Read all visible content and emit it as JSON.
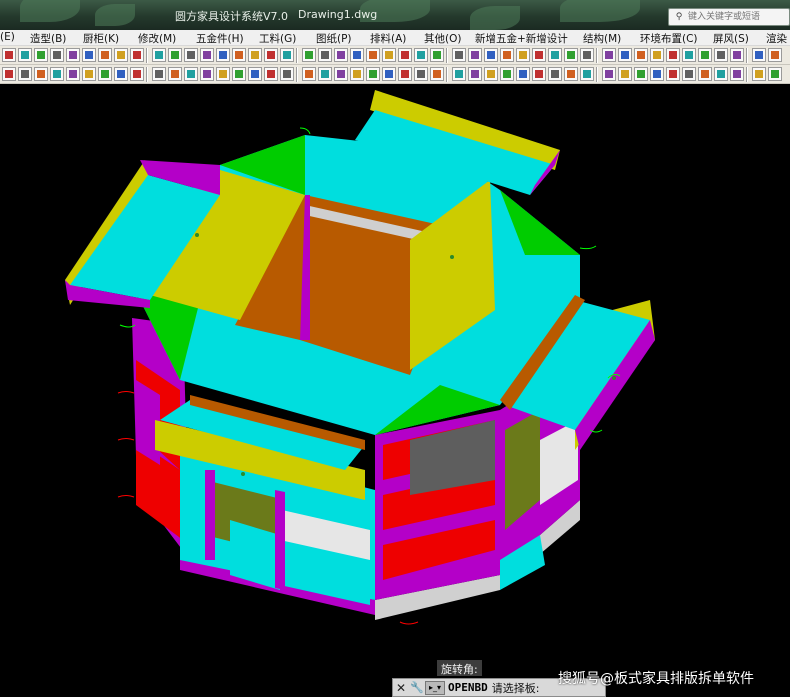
{
  "window": {
    "app_title": "圆方家具设计系统V7.0",
    "document_title": "Drawing1.dwg",
    "help_search_placeholder": "键入关键字或短语"
  },
  "menu": {
    "items": [
      {
        "label": "(E)"
      },
      {
        "label": "造型(B)"
      },
      {
        "label": "厨柜(K)"
      },
      {
        "label": "修改(M)"
      },
      {
        "label": "五金件(H)"
      },
      {
        "label": "工料(G)"
      },
      {
        "label": "图纸(P)"
      },
      {
        "label": "排料(A)"
      },
      {
        "label": "其他(O)"
      },
      {
        "label": "新增五金+新增设计"
      },
      {
        "label": "结构(M)"
      },
      {
        "label": "环境布置(C)"
      },
      {
        "label": "屏风(S)"
      },
      {
        "label": "渲染"
      }
    ]
  },
  "command": {
    "prompt_label": "旋转角:",
    "close_icon": "close-icon",
    "wrench_icon": "wrench-icon",
    "command_name": "OPENBD",
    "prompt_text": "请选择板:"
  },
  "watermark": "搜狐号@板式家具排版拆单软件",
  "colors": {
    "canvas_bg": "#000000",
    "cyan_panel": "#00dede",
    "magenta_edge": "#b400c8",
    "yellow_panel": "#cccc00",
    "green_panel": "#00cc00",
    "red_panel": "#ee0000",
    "brown_panel": "#b85a00"
  }
}
